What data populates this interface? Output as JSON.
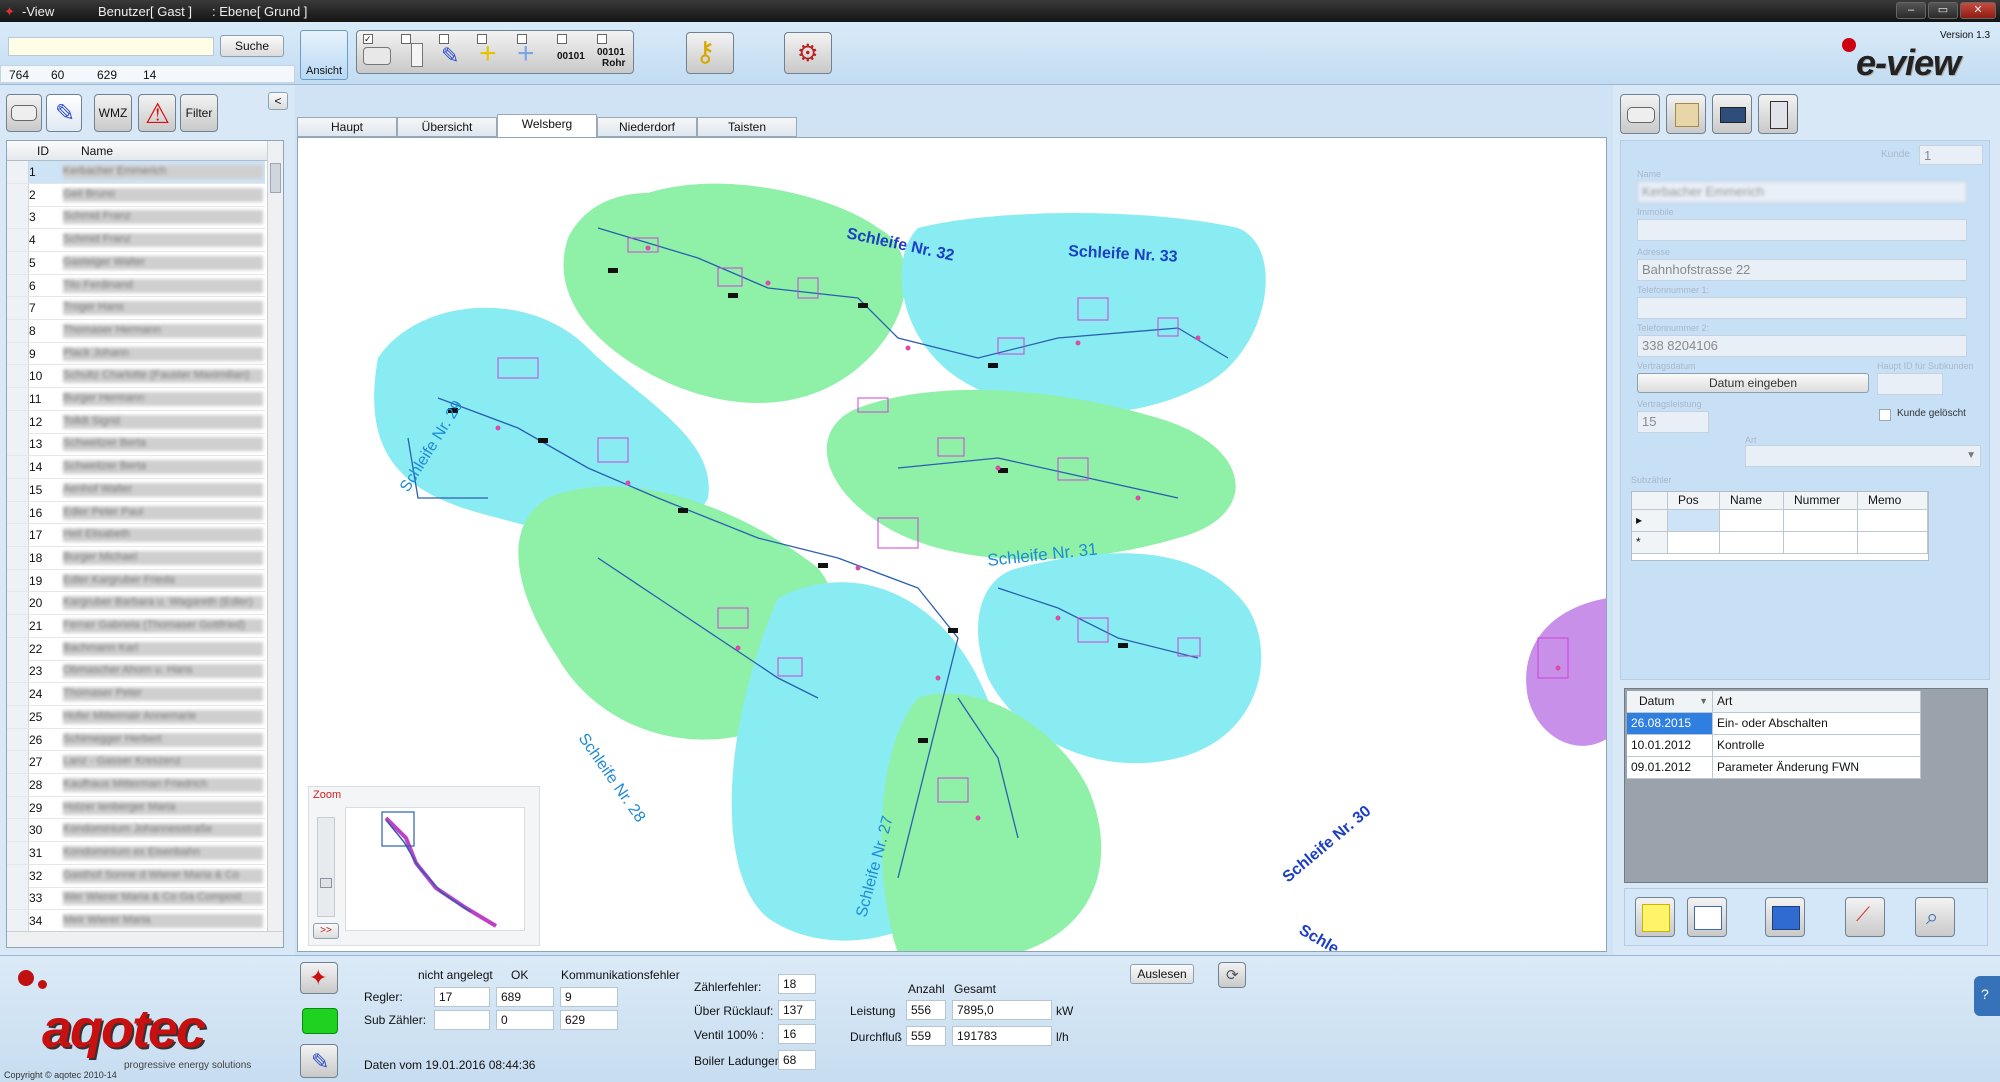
{
  "titlebar": {
    "app": "-View",
    "user": "Benutzer[ Gast ]",
    "level": ": Ebene[ Grund ]",
    "min": "–",
    "max": "▭",
    "close": "✕"
  },
  "topbar": {
    "search_value": "",
    "search_button": "Suche",
    "coords": [
      "764",
      "60",
      "629",
      "14"
    ],
    "ansicht": "Ansicht",
    "tool_labels": {
      "bin1": "00101",
      "bin2": "00101",
      "rohr": "Rohr"
    },
    "version": "Version 1.3",
    "logo": "e-view"
  },
  "left": {
    "tabs": {
      "wmz": "WMZ",
      "filter": "Filter"
    },
    "collapse": "<",
    "headers": {
      "id": "ID",
      "name": "Name"
    },
    "rows": [
      {
        "id": "1",
        "name": "Kerbacher Emmerich"
      },
      {
        "id": "2",
        "name": "Geil Bruno"
      },
      {
        "id": "3",
        "name": "Schmid Franz"
      },
      {
        "id": "4",
        "name": "Schmid Franz"
      },
      {
        "id": "5",
        "name": "Gasteiger Walter"
      },
      {
        "id": "6",
        "name": "Tilo Ferdinand"
      },
      {
        "id": "7",
        "name": "Troger Hans"
      },
      {
        "id": "8",
        "name": "Thomaser Hermann"
      },
      {
        "id": "9",
        "name": "Plack Johann"
      },
      {
        "id": "10",
        "name": "Schultz Charlotte (Fauster Maximilian)"
      },
      {
        "id": "11",
        "name": "Burger Hermann"
      },
      {
        "id": "12",
        "name": "Tolldt Sigrid"
      },
      {
        "id": "13",
        "name": "Schweitzer Berta"
      },
      {
        "id": "14",
        "name": "Schweitzer Berta"
      },
      {
        "id": "15",
        "name": "Aenhof Walter"
      },
      {
        "id": "16",
        "name": "Edler Peter Paul"
      },
      {
        "id": "17",
        "name": "Heil Elisabeth"
      },
      {
        "id": "18",
        "name": "Burger Michael"
      },
      {
        "id": "19",
        "name": "Edler Kargruber Frieda"
      },
      {
        "id": "20",
        "name": "Kargruber Barbara u. Wagareth (Edler)"
      },
      {
        "id": "21",
        "name": "Ferner Gabriela (Thomaser Gottfried)"
      },
      {
        "id": "22",
        "name": "Bachmann Karl"
      },
      {
        "id": "23",
        "name": "Obmascher Ahorn u. Hans"
      },
      {
        "id": "24",
        "name": "Thomaser Peter"
      },
      {
        "id": "25",
        "name": "Hofer Mitteimair Annemarie"
      },
      {
        "id": "26",
        "name": "Schimegger Herbert"
      },
      {
        "id": "27",
        "name": "Lanz - Gasser Kreszenz"
      },
      {
        "id": "28",
        "name": "Kaufhaus Mitterman Friedrich"
      },
      {
        "id": "29",
        "name": "Holzer Ienberger Maria"
      },
      {
        "id": "30",
        "name": "Kondominium Johannesstraße"
      },
      {
        "id": "31",
        "name": "Kondominium ex Eisenbahn"
      },
      {
        "id": "32",
        "name": "Gasthof Sonne d Wierer Maria & Co"
      },
      {
        "id": "33",
        "name": "Wer Wierer Maria & Co Ga Compost"
      },
      {
        "id": "34",
        "name": "Meir Wierer Maria"
      }
    ]
  },
  "center": {
    "tabs": [
      "Haupt",
      "Übersicht",
      "Welsberg",
      "Niederdorf",
      "Taisten"
    ],
    "active_tab": "Welsberg",
    "loop_labels": {
      "s32": "Schleife Nr. 32",
      "s33": "Schleife Nr. 33",
      "s29": "Schleife Nr. 29",
      "s31": "Schleife Nr. 31",
      "s28": "Schleife Nr. 28",
      "s27": "Schleife Nr. 27",
      "s30": "Schleife Nr. 30",
      "scut": "Schle"
    },
    "zoom_label": "Zoom",
    "zoom_button": ">>"
  },
  "right": {
    "kunde_label": "Kunde",
    "kunde_value": "1",
    "name_label": "Name",
    "name_value": "Kerbacher Emmerich",
    "immobile_label": "Immobile",
    "adresse_label": "Adresse",
    "adresse_value": "Bahnhofstrasse 22",
    "tel1_label": "Telefonnummer 1:",
    "tel2_label": "Telefonnummer 2:",
    "tel2_value": "338 8204106",
    "vertrag_label": "Vertragsdatum",
    "datum_button": "Datum eingeben",
    "haupt_label": "Haupt ID für Subkunden",
    "leistung_label": "Vertragsleistung",
    "leistung_value": "15",
    "geloescht_label": "Kunde gelöscht",
    "art_label": "Art",
    "subzaehler_label": "Subzähler",
    "subgrid_headers": [
      "Pos",
      "Name",
      "Nummer",
      "Memo"
    ],
    "history_headers": {
      "datum": "Datum",
      "art": "Art"
    },
    "history": [
      {
        "datum": "26.08.2015",
        "art": "Ein- oder Abschalten"
      },
      {
        "datum": "10.01.2012",
        "art": "Kontrolle"
      },
      {
        "datum": "09.01.2012",
        "art": "Parameter Änderung FWN"
      }
    ]
  },
  "bottom": {
    "logo": "aqotec",
    "slogan": "progressive energy solutions",
    "copyright": "Copyright © aqotec 2010-14",
    "col_headers": {
      "nicht": "nicht angelegt",
      "ok": "OK",
      "komm": "Kommunikationsfehler"
    },
    "regler_label": "Regler:",
    "regler": {
      "nicht": "17",
      "ok": "689",
      "komm": "9"
    },
    "sub_label": "Sub Zähler:",
    "sub": {
      "nicht": "",
      "ok": "0",
      "komm": "629"
    },
    "daten": "Daten vom 19.01.2016   08:44:36",
    "zaehlerfehler_label": "Zählerfehler:",
    "zaehlerfehler": "18",
    "ruecklauf_label": "Über Rücklauf:",
    "ruecklauf": "137",
    "ventil_label": "Ventil 100% :",
    "ventil": "16",
    "boiler_label": "Boiler Ladungen",
    "boiler": "68",
    "auslesen": "Auslesen",
    "anzahl_label": "Anzahl",
    "gesamt_label": "Gesamt",
    "leistung_label": "Leistung",
    "leistung_anzahl": "556",
    "leistung_gesamt": "7895,0",
    "leistung_unit": "kW",
    "durchfluss_label": "Durchfluß",
    "durchfluss_anzahl": "559",
    "durchfluss_gesamt": "191783",
    "durchfluss_unit": "l/h"
  }
}
